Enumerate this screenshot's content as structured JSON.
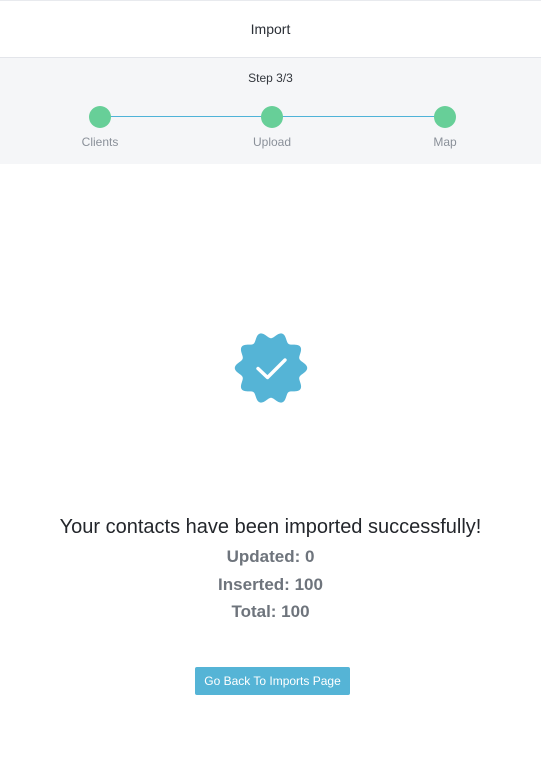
{
  "header": {
    "title": "Import"
  },
  "stepper": {
    "step_text": "Step 3/3",
    "steps": [
      {
        "label": "Clients"
      },
      {
        "label": "Upload"
      },
      {
        "label": "Map"
      }
    ]
  },
  "result": {
    "icon": "check-badge-icon",
    "message": "Your contacts have been imported successfully!",
    "updated": "Updated: 0",
    "inserted": "Inserted: 100",
    "total": "Total: 100"
  },
  "actions": {
    "back_label": "Go Back To Imports Page"
  },
  "colors": {
    "step_done": "#67cf98",
    "step_line": "#4fb3d8",
    "badge": "#55b4d6",
    "button": "#55b4d6"
  }
}
